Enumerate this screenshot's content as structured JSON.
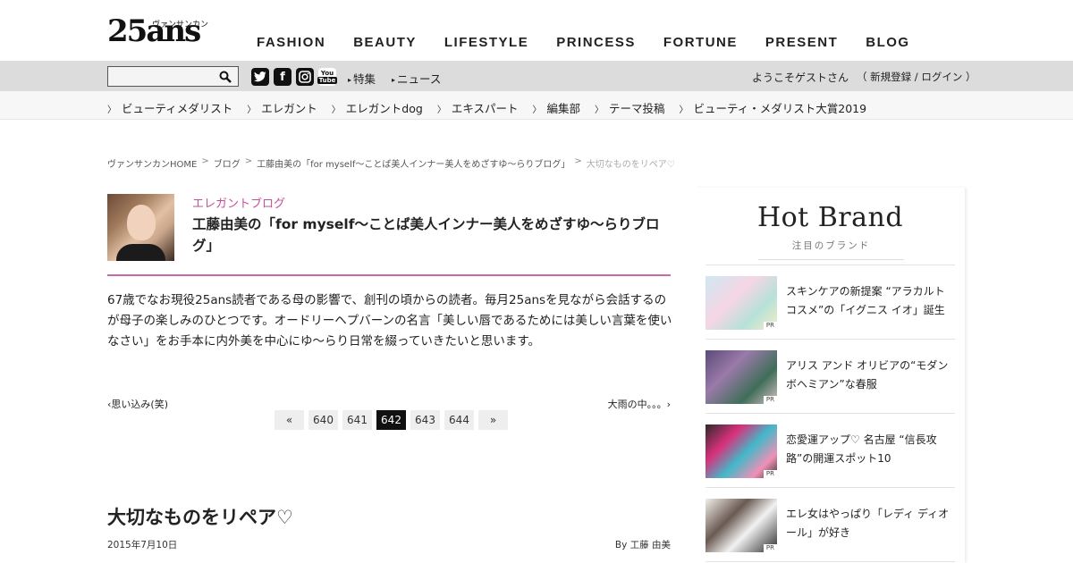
{
  "brand": {
    "logo_main": "25ans",
    "logo_kana": "ヴァンサンカン"
  },
  "main_nav": [
    "FASHION",
    "BEAUTY",
    "LIFESTYLE",
    "PRINCESS",
    "FORTUNE",
    "PRESENT",
    "BLOG"
  ],
  "search": {
    "placeholder": "",
    "button_icon": "search-icon"
  },
  "social": {
    "twitter": "twitter-icon",
    "facebook": "facebook-icon",
    "instagram": "instagram-icon",
    "youtube_top": "You",
    "youtube_bottom": "Tube"
  },
  "gray_links": [
    "特集",
    "ニュース"
  ],
  "account": {
    "welcome": "ようこそゲストさん",
    "auth": "（ 新規登録 / ログイン ）"
  },
  "sub_nav": [
    "ビューティメダリスト",
    "エレガント",
    "エレガントdog",
    "エキスパート",
    "編集部",
    "テーマ投稿",
    "ビューティ・メダリスト大賞2019"
  ],
  "breadcrumb": {
    "items": [
      "ヴァンサンカンHOME",
      "ブログ",
      "工藤由美の「for myself〜ことば美人インナー美人をめざすゆ〜らりブログ」"
    ],
    "current": "大切なものをリペア♡",
    "separator": ">"
  },
  "blog": {
    "category": "エレガントブログ",
    "title": "工藤由美の「for myself〜ことば美人インナー美人をめざすゆ〜らりブログ」",
    "intro": "67歳でなお現役25ans読者である母の影響で、創刊の頃からの読者。毎月25ansを見ながら会話するのが母子の楽しみのひとつです。オードリーヘプバーンの名言「美しい唇であるためには美しい言葉を使いなさい」をお手本に内外美を中心にゆ〜らり日常を綴っていきたいと思います。"
  },
  "nav_links": {
    "prev": "‹思い込み(笑)",
    "next": "大雨の中。。。›"
  },
  "pagination": {
    "items": [
      "«",
      "640",
      "641",
      "642",
      "643",
      "644",
      "»"
    ],
    "active": "642"
  },
  "post": {
    "title": "大切なものをリペア♡",
    "date": "2015年7月10日",
    "author": "By 工藤 由美"
  },
  "sidebar": {
    "title": "Hot Brand",
    "subtitle": "注目のブランド",
    "pr_label": "PR",
    "items": [
      {
        "text": "スキンケアの新提案 “アラカルトコスメ”の「イグニス イオ」誕生"
      },
      {
        "text": "アリス アンド オリビアの“モダンボヘミアン”な春服"
      },
      {
        "text": "恋愛運アップ♡ 名古屋 “信長攻路”の開運スポット10"
      },
      {
        "text": "エレ女はやっぱり「レディ ディオール」が好き"
      }
    ]
  },
  "colors": {
    "accent_pink": "#c74f98",
    "rule_pink": "#c76aa6",
    "gray_bar": "#dcdcdc"
  }
}
